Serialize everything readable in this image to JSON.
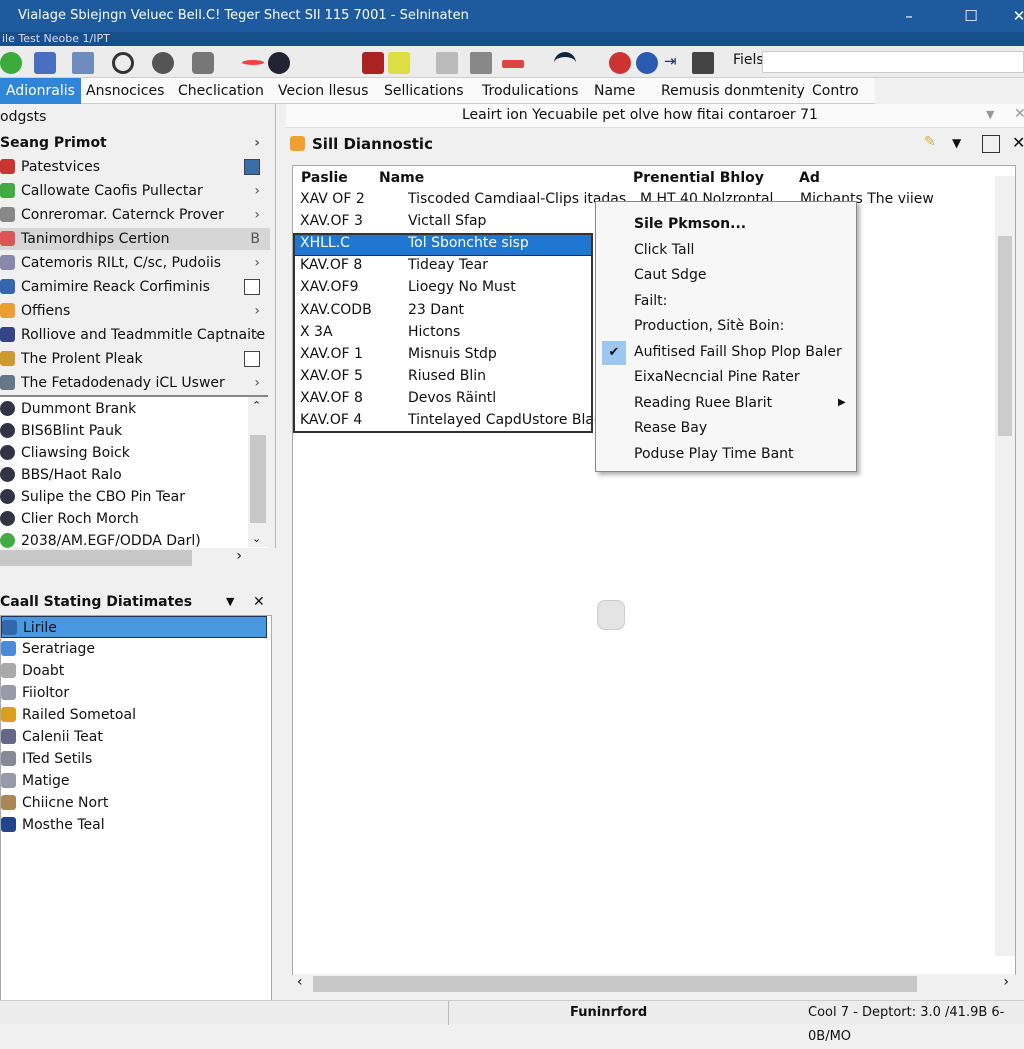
{
  "window": {
    "title": "Vialage Sbiejngn Veluec Bell.C! Teger Shect SIl 115 7001 - Selninaten",
    "menu": "ile Test Neobe 1/IPT",
    "search_label": "Fiels"
  },
  "tabs": [
    "Adionralis",
    "Ansnocices",
    "Checlication",
    "Vecion llesus",
    "Sellications",
    "Trodulications",
    "Name",
    "Remusis donmtenity",
    "Contro"
  ],
  "left": {
    "header": "odgsts",
    "tree_title": "Seang Primot",
    "tree": [
      {
        "label": "Patestvices",
        "end": "box-blue"
      },
      {
        "label": "Callowate Caofis Pullectar",
        "end": ">"
      },
      {
        "label": "Conreromar. Caternck Prover",
        "end": ">"
      },
      {
        "label": "Tanimordhips Certion",
        "end": "B"
      },
      {
        "label": "Catemoris RILt, C/sc, Pudoiis",
        "end": ">"
      },
      {
        "label": "Camimire Reack Corfiminis",
        "end": "box"
      },
      {
        "label": "Offiens",
        "end": ">"
      },
      {
        "label": "Rolliove and Teadmmitle Captnaite",
        "end": ">"
      },
      {
        "label": "The Prolent Pleak",
        "end": "box"
      },
      {
        "label": "The Fetadodenady iCL Uswer",
        "end": ">"
      }
    ],
    "list": [
      "Dummont Brank",
      "BIS6Blint Pauk",
      "Cliawsing Boick",
      "BBS/Haot Ralo",
      "Sulipe the CBO Pin Tear",
      "Clier Roch Morch",
      "2038/AM.EGF/ODDA Darl)"
    ],
    "panel_title": "Caall Stating Diatimates",
    "panel_items": [
      "Lirile",
      "Seratriage",
      "Doabt",
      "Fiioltor",
      "Railed Sometoal",
      "Calenii Teat",
      "ITed Setils",
      "Matige",
      "Chiicne Nort",
      "Mosthe Teal"
    ]
  },
  "main": {
    "filter": "Leairt ion Yecuabile pet olve how fitai contaroer 71",
    "panel_title": "Sill Diannostic",
    "columns": [
      "Paslie",
      "Name",
      "Prenential Bhloy",
      "Ad"
    ],
    "rows": [
      [
        "XAV OF 2",
        "Tiscoded Camdiaal-Clips itadas",
        "M.HT 40 Nolzrontal",
        "Michants The viiew"
      ],
      [
        "XAV.OF 3",
        "Victall Sfap"
      ],
      [
        "XHLL.C",
        "Tol Sbonchte sisp"
      ],
      [
        "KAV.OF 8",
        "Tideay Tear"
      ],
      [
        "XAV.OF9",
        "Lioegy No Must"
      ],
      [
        "XAV.CODB",
        "23 Dant"
      ],
      [
        "X 3A",
        "Hictons"
      ],
      [
        "XAV.OF 1",
        "Misnuis Stdp"
      ],
      [
        "XAV.OF 5",
        "Riused Blin"
      ],
      [
        "XAV.OF 8",
        "Devos Räintl"
      ],
      [
        "KAV.OF 4",
        "Tintelayed CapdUstore Blag"
      ]
    ],
    "selected_row": 2
  },
  "context_menu": {
    "items": [
      "Sile Pkmson...",
      "Click Tall",
      "Caut Sdge",
      "Failt:",
      "Production, Sitè Boin:",
      "Aufitised Faill Shop Plop Baler",
      "EixaNecncial Pine Rater",
      "Reading Ruee Blarit",
      "Rease Bay",
      "Poduse Play Time Bant"
    ],
    "checked": 5,
    "submenu": 7
  },
  "status": {
    "center": "Funinrford",
    "right": "Cool 7 - Deptort: 3.0 /41.9B 6-0B/MO"
  },
  "colors": {
    "titlebar": "#1d5a9e",
    "accent": "#2f86d9"
  }
}
